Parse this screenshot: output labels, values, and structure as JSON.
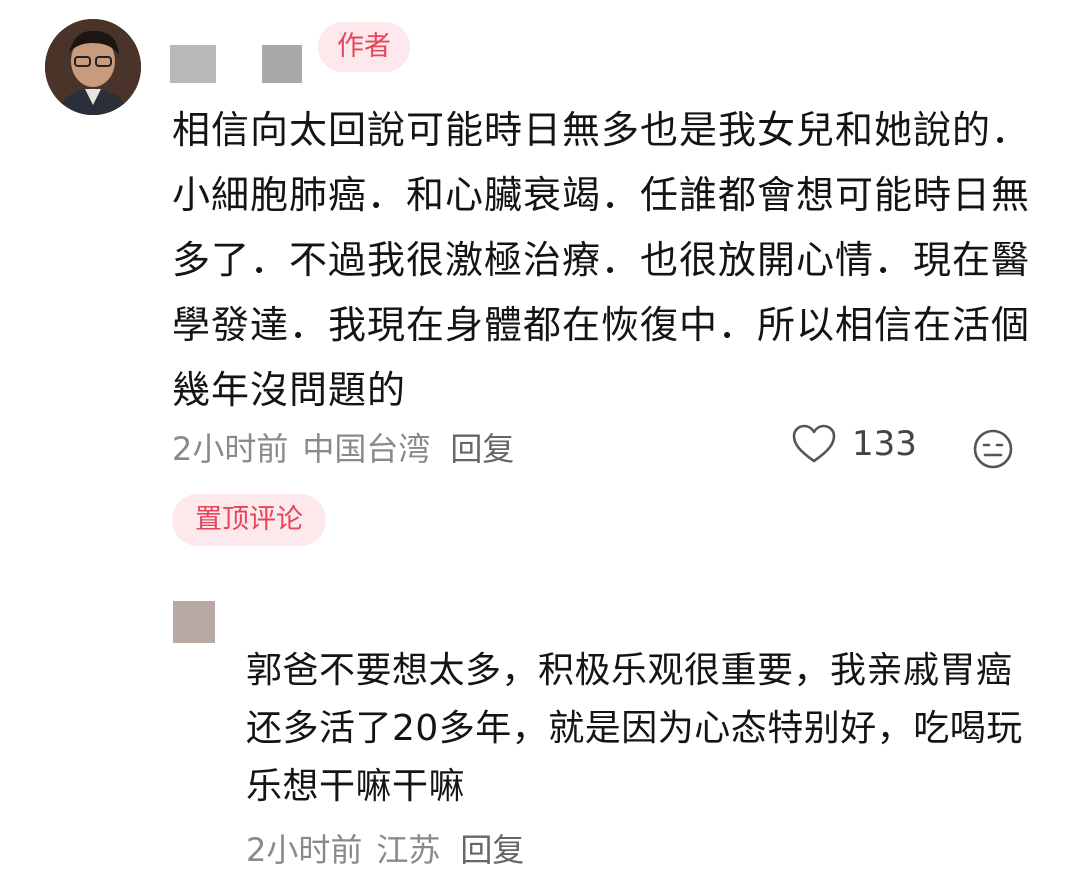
{
  "comments": [
    {
      "author_tag": "作者",
      "text": "相信向太回說可能時日無多也是我女兒和她說的．小細胞肺癌．和心臟衰竭．任誰都會想可能時日無多了．不過我很激極治療．也很放開心情．現在醫學發達．我現在身體都在恢復中．所以相信在活個幾年沒問題的",
      "time": "2小时前",
      "location": "中国台湾",
      "reply_label": "回复",
      "like_count": "133",
      "pinned_label": "置顶评论"
    },
    {
      "text": "郭爸不要想太多，积极乐观很重要，我亲戚胃癌还多活了20多年，就是因为心态特别好，吃喝玩乐想干嘛干嘛",
      "time": "2小时前",
      "location": "江苏",
      "reply_label": "回复"
    }
  ],
  "colors": {
    "accent": "#e8445a",
    "tag_bg": "#fde9ec",
    "meta": "#8a8a8a"
  },
  "icons": [
    "heart-icon",
    "emoji-icon"
  ]
}
